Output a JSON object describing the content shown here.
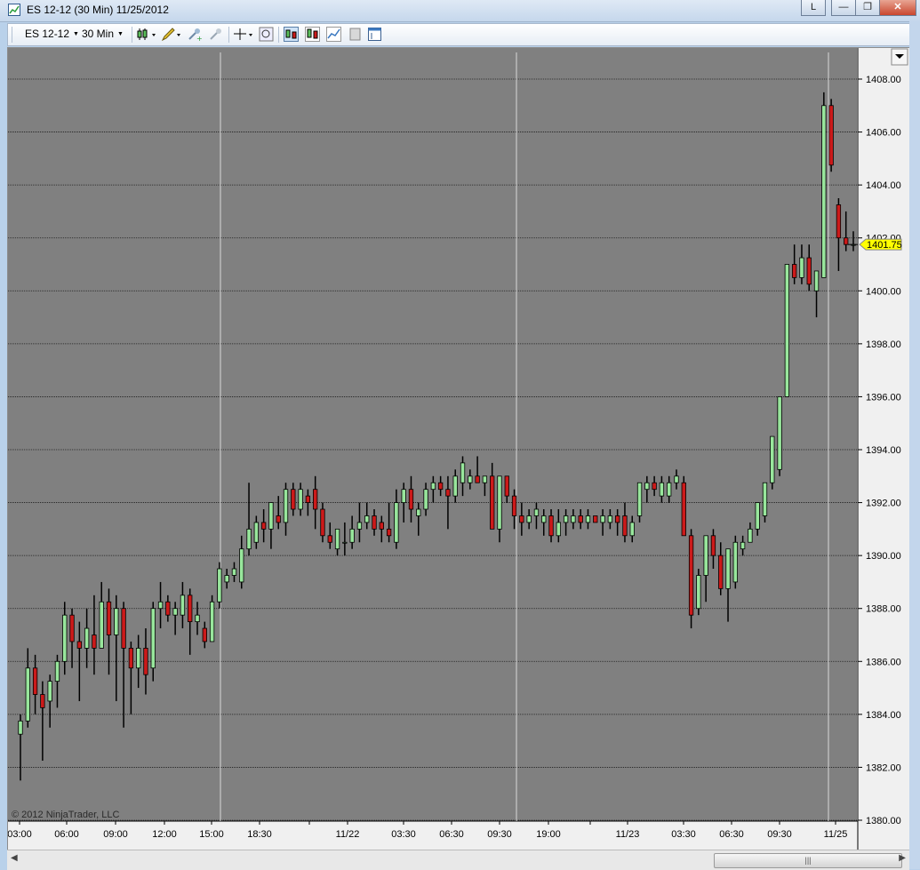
{
  "window": {
    "title": "ES 12-12 (30 Min)  11/25/2012",
    "hint": "L",
    "buttons": {
      "minimize": "▭",
      "restore": "❐",
      "close": "✕"
    }
  },
  "toolbar": {
    "instrument": "ES 12-12",
    "interval": "30 Min",
    "icons": [
      "bar-type-icon",
      "pencil-icon",
      "add-indicator-icon",
      "strategy-icon",
      "crosshair-icon",
      "zoom-icon",
      "data-box-icon",
      "chart-style-icon",
      "strategy-chart-icon",
      "template-icon",
      "properties-icon"
    ]
  },
  "chart": {
    "copyright": "© 2012 NinjaTrader, LLC",
    "last_price_label": "1401.75",
    "colors": {
      "background": "#808080",
      "up": "#98e69c",
      "down": "#cc1a1a",
      "wick": "#000000",
      "last_price": "#ffff00"
    }
  },
  "chart_data": {
    "type": "candlestick",
    "title": "",
    "y_ticks": [
      "1408.00",
      "1406.00",
      "1404.00",
      "1402.00",
      "1400.00",
      "1398.00",
      "1396.00",
      "1394.00",
      "1392.00",
      "1390.00",
      "1388.00",
      "1386.00",
      "1384.00",
      "1382.00",
      "1380.00"
    ],
    "x_ticks": [
      "03:00",
      "06:00",
      "09:00",
      "12:00",
      "15:00",
      "18:30",
      "11/22",
      "03:30",
      "06:30",
      "09:30",
      "19:00",
      "11/23",
      "03:30",
      "06:30",
      "09:30",
      "11/25"
    ],
    "ylim": [
      1380,
      1409
    ],
    "last_price": 1401.75,
    "candles": [
      {
        "o": 1383.25,
        "h": 1384.0,
        "l": 1381.5,
        "c": 1383.75
      },
      {
        "o": 1383.75,
        "h": 1386.5,
        "l": 1383.5,
        "c": 1385.75
      },
      {
        "o": 1385.75,
        "h": 1386.25,
        "l": 1384.0,
        "c": 1384.75
      },
      {
        "o": 1384.75,
        "h": 1385.25,
        "l": 1382.25,
        "c": 1384.25
      },
      {
        "o": 1384.5,
        "h": 1385.5,
        "l": 1383.5,
        "c": 1385.25
      },
      {
        "o": 1385.25,
        "h": 1386.25,
        "l": 1384.25,
        "c": 1386.0
      },
      {
        "o": 1386.0,
        "h": 1388.25,
        "l": 1385.5,
        "c": 1387.75
      },
      {
        "o": 1387.75,
        "h": 1388.0,
        "l": 1385.75,
        "c": 1386.75
      },
      {
        "o": 1386.75,
        "h": 1387.5,
        "l": 1384.5,
        "c": 1386.5
      },
      {
        "o": 1386.5,
        "h": 1388.0,
        "l": 1385.75,
        "c": 1387.25
      },
      {
        "o": 1387.0,
        "h": 1388.5,
        "l": 1385.5,
        "c": 1386.5
      },
      {
        "o": 1386.5,
        "h": 1389.0,
        "l": 1386.5,
        "c": 1388.25
      },
      {
        "o": 1388.25,
        "h": 1388.75,
        "l": 1385.5,
        "c": 1387.0
      },
      {
        "o": 1387.0,
        "h": 1388.5,
        "l": 1384.5,
        "c": 1388.0
      },
      {
        "o": 1388.0,
        "h": 1388.25,
        "l": 1383.5,
        "c": 1386.5
      },
      {
        "o": 1386.5,
        "h": 1386.75,
        "l": 1384.0,
        "c": 1385.75
      },
      {
        "o": 1385.75,
        "h": 1387.0,
        "l": 1385.0,
        "c": 1386.5
      },
      {
        "o": 1386.5,
        "h": 1387.25,
        "l": 1384.75,
        "c": 1385.5
      },
      {
        "o": 1385.75,
        "h": 1388.25,
        "l": 1385.25,
        "c": 1388.0
      },
      {
        "o": 1388.0,
        "h": 1389.0,
        "l": 1387.25,
        "c": 1388.25
      },
      {
        "o": 1388.25,
        "h": 1388.5,
        "l": 1387.5,
        "c": 1387.75
      },
      {
        "o": 1387.75,
        "h": 1388.25,
        "l": 1387.0,
        "c": 1388.0
      },
      {
        "o": 1387.75,
        "h": 1389.0,
        "l": 1387.25,
        "c": 1388.5
      },
      {
        "o": 1388.5,
        "h": 1388.75,
        "l": 1386.25,
        "c": 1387.5
      },
      {
        "o": 1387.5,
        "h": 1388.25,
        "l": 1387.0,
        "c": 1387.75
      },
      {
        "o": 1387.25,
        "h": 1387.5,
        "l": 1386.5,
        "c": 1386.75
      },
      {
        "o": 1386.75,
        "h": 1388.5,
        "l": 1386.75,
        "c": 1388.25
      },
      {
        "o": 1388.25,
        "h": 1389.75,
        "l": 1388.0,
        "c": 1389.5
      },
      {
        "o": 1389.0,
        "h": 1389.5,
        "l": 1388.75,
        "c": 1389.25
      },
      {
        "o": 1389.25,
        "h": 1389.75,
        "l": 1389.0,
        "c": 1389.5
      },
      {
        "o": 1389.0,
        "h": 1390.75,
        "l": 1388.75,
        "c": 1390.25
      },
      {
        "o": 1390.25,
        "h": 1392.75,
        "l": 1390.0,
        "c": 1391.0
      },
      {
        "o": 1390.5,
        "h": 1391.5,
        "l": 1390.25,
        "c": 1391.25
      },
      {
        "o": 1391.25,
        "h": 1391.75,
        "l": 1390.5,
        "c": 1391.0
      },
      {
        "o": 1391.0,
        "h": 1392.0,
        "l": 1390.25,
        "c": 1392.0
      },
      {
        "o": 1391.5,
        "h": 1392.25,
        "l": 1391.0,
        "c": 1391.25
      },
      {
        "o": 1391.25,
        "h": 1392.75,
        "l": 1390.75,
        "c": 1392.5
      },
      {
        "o": 1392.5,
        "h": 1392.75,
        "l": 1391.5,
        "c": 1391.75
      },
      {
        "o": 1391.75,
        "h": 1392.75,
        "l": 1391.5,
        "c": 1392.5
      },
      {
        "o": 1392.25,
        "h": 1392.5,
        "l": 1391.5,
        "c": 1392.0
      },
      {
        "o": 1392.5,
        "h": 1393.0,
        "l": 1391.0,
        "c": 1391.75
      },
      {
        "o": 1391.75,
        "h": 1392.0,
        "l": 1390.5,
        "c": 1390.75
      },
      {
        "o": 1390.75,
        "h": 1391.25,
        "l": 1390.25,
        "c": 1390.5
      },
      {
        "o": 1390.25,
        "h": 1391.0,
        "l": 1390.0,
        "c": 1391.0
      },
      {
        "o": 1390.5,
        "h": 1391.25,
        "l": 1390.0,
        "c": 1390.5
      },
      {
        "o": 1390.5,
        "h": 1391.5,
        "l": 1390.25,
        "c": 1391.0
      },
      {
        "o": 1391.0,
        "h": 1392.0,
        "l": 1390.5,
        "c": 1391.25
      },
      {
        "o": 1391.25,
        "h": 1392.0,
        "l": 1391.0,
        "c": 1391.5
      },
      {
        "o": 1391.5,
        "h": 1391.75,
        "l": 1390.75,
        "c": 1391.0
      },
      {
        "o": 1391.25,
        "h": 1391.5,
        "l": 1390.5,
        "c": 1391.0
      },
      {
        "o": 1391.0,
        "h": 1392.0,
        "l": 1390.5,
        "c": 1390.75
      },
      {
        "o": 1390.5,
        "h": 1392.5,
        "l": 1390.25,
        "c": 1392.0
      },
      {
        "o": 1392.0,
        "h": 1392.75,
        "l": 1391.25,
        "c": 1392.5
      },
      {
        "o": 1392.5,
        "h": 1393.0,
        "l": 1391.25,
        "c": 1391.75
      },
      {
        "o": 1391.5,
        "h": 1392.0,
        "l": 1390.75,
        "c": 1391.75
      },
      {
        "o": 1391.75,
        "h": 1392.75,
        "l": 1391.5,
        "c": 1392.5
      },
      {
        "o": 1392.5,
        "h": 1393.0,
        "l": 1392.0,
        "c": 1392.75
      },
      {
        "o": 1392.75,
        "h": 1393.0,
        "l": 1392.25,
        "c": 1392.5
      },
      {
        "o": 1392.5,
        "h": 1393.0,
        "l": 1391.0,
        "c": 1392.25
      },
      {
        "o": 1392.25,
        "h": 1393.25,
        "l": 1392.0,
        "c": 1393.0
      },
      {
        "o": 1392.75,
        "h": 1393.75,
        "l": 1392.25,
        "c": 1393.5
      },
      {
        "o": 1392.75,
        "h": 1393.25,
        "l": 1392.5,
        "c": 1393.0
      },
      {
        "o": 1393.0,
        "h": 1393.75,
        "l": 1392.75,
        "c": 1392.75
      },
      {
        "o": 1392.75,
        "h": 1393.0,
        "l": 1392.25,
        "c": 1393.0
      },
      {
        "o": 1393.0,
        "h": 1393.5,
        "l": 1391.0,
        "c": 1391.0
      },
      {
        "o": 1391.0,
        "h": 1393.0,
        "l": 1390.5,
        "c": 1393.0
      },
      {
        "o": 1393.0,
        "h": 1393.0,
        "l": 1392.0,
        "c": 1392.25
      },
      {
        "o": 1392.25,
        "h": 1392.5,
        "l": 1391.0,
        "c": 1391.5
      },
      {
        "o": 1391.5,
        "h": 1392.0,
        "l": 1390.75,
        "c": 1391.25
      },
      {
        "o": 1391.25,
        "h": 1391.75,
        "l": 1391.0,
        "c": 1391.5
      },
      {
        "o": 1391.5,
        "h": 1392.0,
        "l": 1391.0,
        "c": 1391.75
      },
      {
        "o": 1391.25,
        "h": 1391.75,
        "l": 1390.75,
        "c": 1391.5
      },
      {
        "o": 1391.5,
        "h": 1391.75,
        "l": 1390.5,
        "c": 1390.75
      },
      {
        "o": 1390.75,
        "h": 1391.75,
        "l": 1390.5,
        "c": 1391.25
      },
      {
        "o": 1391.25,
        "h": 1391.75,
        "l": 1390.75,
        "c": 1391.5
      },
      {
        "o": 1391.25,
        "h": 1391.75,
        "l": 1391.0,
        "c": 1391.5
      },
      {
        "o": 1391.5,
        "h": 1391.75,
        "l": 1391.0,
        "c": 1391.25
      },
      {
        "o": 1391.25,
        "h": 1391.75,
        "l": 1391.0,
        "c": 1391.5
      },
      {
        "o": 1391.5,
        "h": 1391.5,
        "l": 1391.25,
        "c": 1391.25
      },
      {
        "o": 1391.25,
        "h": 1391.75,
        "l": 1390.75,
        "c": 1391.5
      },
      {
        "o": 1391.25,
        "h": 1391.75,
        "l": 1391.0,
        "c": 1391.5
      },
      {
        "o": 1391.5,
        "h": 1391.75,
        "l": 1390.75,
        "c": 1391.25
      },
      {
        "o": 1391.5,
        "h": 1392.0,
        "l": 1390.5,
        "c": 1390.75
      },
      {
        "o": 1390.75,
        "h": 1391.5,
        "l": 1390.5,
        "c": 1391.25
      },
      {
        "o": 1391.5,
        "h": 1392.75,
        "l": 1391.25,
        "c": 1392.75
      },
      {
        "o": 1392.5,
        "h": 1393.0,
        "l": 1392.0,
        "c": 1392.75
      },
      {
        "o": 1392.75,
        "h": 1393.0,
        "l": 1392.25,
        "c": 1392.5
      },
      {
        "o": 1392.25,
        "h": 1393.0,
        "l": 1392.0,
        "c": 1392.75
      },
      {
        "o": 1392.25,
        "h": 1393.0,
        "l": 1392.0,
        "c": 1392.75
      },
      {
        "o": 1392.75,
        "h": 1393.25,
        "l": 1392.5,
        "c": 1393.0
      },
      {
        "o": 1392.75,
        "h": 1393.0,
        "l": 1390.75,
        "c": 1390.75
      },
      {
        "o": 1390.75,
        "h": 1391.0,
        "l": 1387.25,
        "c": 1387.75
      },
      {
        "o": 1388.0,
        "h": 1389.5,
        "l": 1387.75,
        "c": 1389.25
      },
      {
        "o": 1389.25,
        "h": 1390.75,
        "l": 1388.25,
        "c": 1390.75
      },
      {
        "o": 1390.75,
        "h": 1391.0,
        "l": 1389.5,
        "c": 1390.0
      },
      {
        "o": 1390.0,
        "h": 1390.5,
        "l": 1388.5,
        "c": 1388.75
      },
      {
        "o": 1388.75,
        "h": 1390.0,
        "l": 1387.5,
        "c": 1390.25
      },
      {
        "o": 1389.0,
        "h": 1390.75,
        "l": 1388.75,
        "c": 1390.5
      },
      {
        "o": 1390.25,
        "h": 1390.75,
        "l": 1390.0,
        "c": 1390.5
      },
      {
        "o": 1390.5,
        "h": 1391.25,
        "l": 1390.5,
        "c": 1391.0
      },
      {
        "o": 1391.0,
        "h": 1392.0,
        "l": 1390.75,
        "c": 1392.0
      },
      {
        "o": 1391.5,
        "h": 1392.75,
        "l": 1391.25,
        "c": 1392.75
      },
      {
        "o": 1392.75,
        "h": 1394.5,
        "l": 1392.5,
        "c": 1394.5
      },
      {
        "o": 1393.25,
        "h": 1395.5,
        "l": 1393.0,
        "c": 1396.0
      },
      {
        "o": 1396.0,
        "h": 1401.0,
        "l": 1396.0,
        "c": 1401.0
      },
      {
        "o": 1401.0,
        "h": 1401.75,
        "l": 1400.25,
        "c": 1400.5
      },
      {
        "o": 1400.5,
        "h": 1401.75,
        "l": 1400.25,
        "c": 1401.25
      },
      {
        "o": 1401.25,
        "h": 1401.75,
        "l": 1400.0,
        "c": 1400.25
      },
      {
        "o": 1400.0,
        "h": 1400.75,
        "l": 1399.0,
        "c": 1400.75
      },
      {
        "o": 1400.5,
        "h": 1407.5,
        "l": 1400.5,
        "c": 1407.0
      },
      {
        "o": 1407.0,
        "h": 1407.25,
        "l": 1404.5,
        "c": 1404.75
      },
      {
        "o": 1403.25,
        "h": 1403.5,
        "l": 1400.75,
        "c": 1402.0
      },
      {
        "o": 1402.0,
        "h": 1403.0,
        "l": 1401.5,
        "c": 1401.75
      },
      {
        "o": 1401.75,
        "h": 1402.25,
        "l": 1401.5,
        "c": 1401.75
      }
    ]
  }
}
